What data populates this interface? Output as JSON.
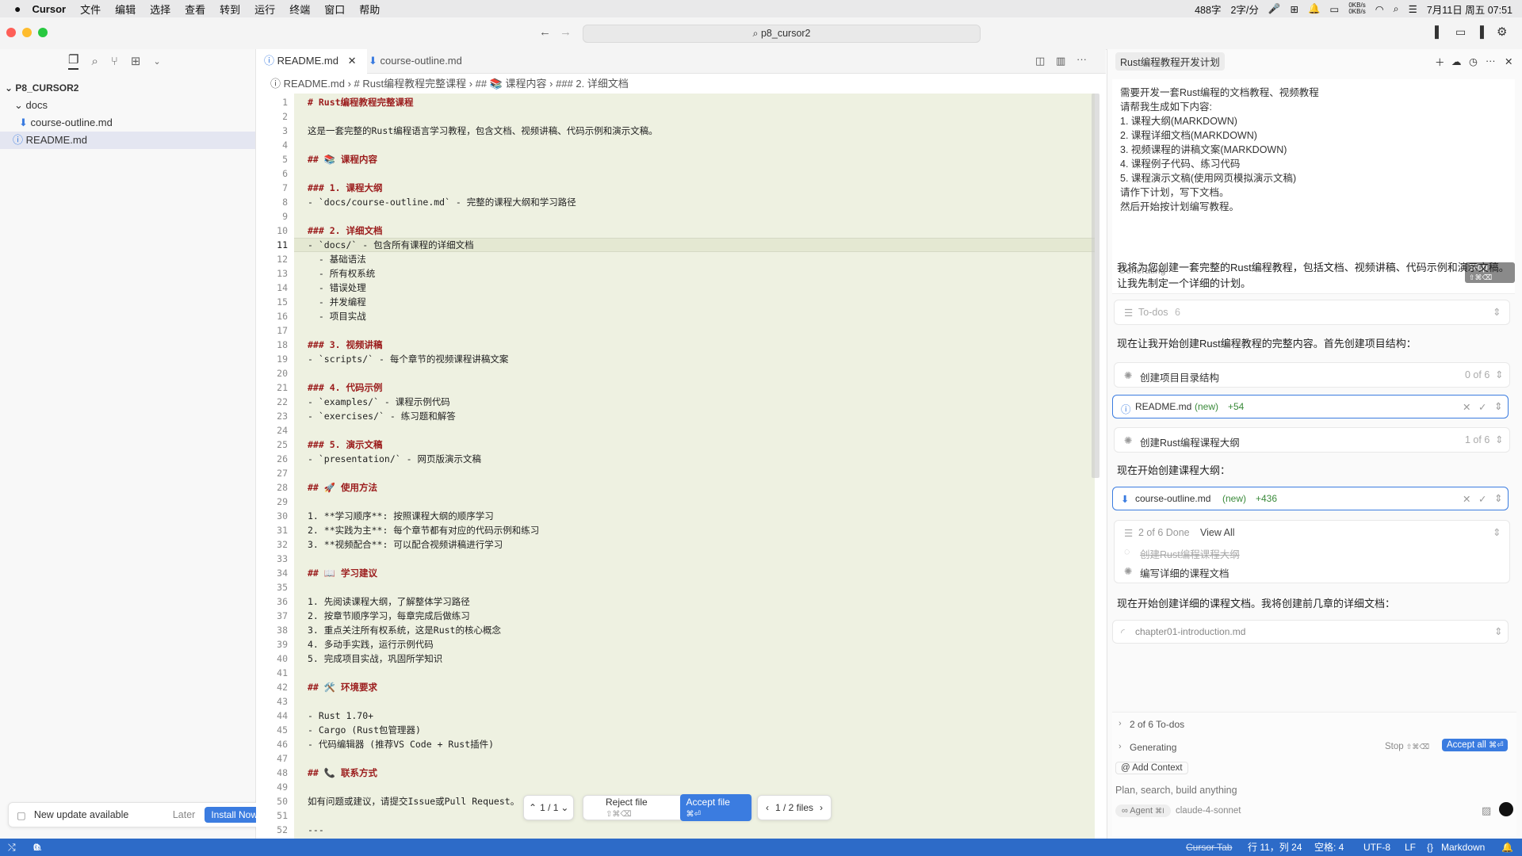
{
  "menubar": {
    "app": "Cursor",
    "items": [
      "文件",
      "编辑",
      "选择",
      "查看",
      "转到",
      "运行",
      "终端",
      "窗口",
      "帮助"
    ],
    "word_count": "488字",
    "speed": "2字/分",
    "net_up": "0KB/s",
    "net_down": "0KB/s",
    "datetime": "7月11日 周五 07:51"
  },
  "titlebar": {
    "project": "p8_cursor2"
  },
  "sidebar": {
    "root": "P8_CURSOR2",
    "folder": "docs",
    "file_in_folder": "course-outline.md",
    "file_root": "README.md",
    "update_text": "New update available",
    "later": "Later",
    "install": "Install Now"
  },
  "editor": {
    "tabs": [
      {
        "label": "README.md"
      },
      {
        "label": "course-outline.md"
      }
    ],
    "breadcrumb": {
      "file": "README.md",
      "h1": "# Rust编程教程完整课程",
      "h2": "## 📚 课程内容",
      "h3": "### 2. 详细文档"
    },
    "current_line": 11,
    "lines": [
      {
        "n": "1",
        "t": "# Rust编程教程完整课程",
        "h": true
      },
      {
        "n": "2",
        "t": ""
      },
      {
        "n": "3",
        "t": "这是一套完整的Rust编程语言学习教程，包含文档、视频讲稿、代码示例和演示文稿。"
      },
      {
        "n": "4",
        "t": ""
      },
      {
        "n": "5",
        "t": "## 📚 课程内容",
        "h": true
      },
      {
        "n": "6",
        "t": ""
      },
      {
        "n": "7",
        "t": "### 1. 课程大纲",
        "h": true
      },
      {
        "n": "8",
        "t": "- `docs/course-outline.md` - 完整的课程大纲和学习路径"
      },
      {
        "n": "9",
        "t": ""
      },
      {
        "n": "10",
        "t": "### 2. 详细文档",
        "h": true
      },
      {
        "n": "11",
        "t": "- `docs/` - 包含所有课程的详细文档"
      },
      {
        "n": "12",
        "t": "  - 基础语法"
      },
      {
        "n": "13",
        "t": "  - 所有权系统"
      },
      {
        "n": "14",
        "t": "  - 错误处理"
      },
      {
        "n": "15",
        "t": "  - 并发编程"
      },
      {
        "n": "16",
        "t": "  - 项目实战"
      },
      {
        "n": "17",
        "t": ""
      },
      {
        "n": "18",
        "t": "### 3. 视频讲稿",
        "h": true
      },
      {
        "n": "19",
        "t": "- `scripts/` - 每个章节的视频课程讲稿文案"
      },
      {
        "n": "20",
        "t": ""
      },
      {
        "n": "21",
        "t": "### 4. 代码示例",
        "h": true
      },
      {
        "n": "22",
        "t": "- `examples/` - 课程示例代码"
      },
      {
        "n": "23",
        "t": "- `exercises/` - 练习题和解答"
      },
      {
        "n": "24",
        "t": ""
      },
      {
        "n": "25",
        "t": "### 5. 演示文稿",
        "h": true
      },
      {
        "n": "26",
        "t": "- `presentation/` - 网页版演示文稿"
      },
      {
        "n": "27",
        "t": ""
      },
      {
        "n": "28",
        "t": "## 🚀 使用方法",
        "h": true
      },
      {
        "n": "29",
        "t": ""
      },
      {
        "n": "30",
        "t": "1. **学习顺序**: 按照课程大纲的顺序学习"
      },
      {
        "n": "31",
        "t": "2. **实践为主**: 每个章节都有对应的代码示例和练习"
      },
      {
        "n": "32",
        "t": "3. **视频配合**: 可以配合视频讲稿进行学习"
      },
      {
        "n": "33",
        "t": ""
      },
      {
        "n": "34",
        "t": "## 📖 学习建议",
        "h": true
      },
      {
        "n": "35",
        "t": ""
      },
      {
        "n": "36",
        "t": "1. 先阅读课程大纲，了解整体学习路径"
      },
      {
        "n": "37",
        "t": "2. 按章节顺序学习，每章完成后做练习"
      },
      {
        "n": "38",
        "t": "3. 重点关注所有权系统，这是Rust的核心概念"
      },
      {
        "n": "39",
        "t": "4. 多动手实践，运行示例代码"
      },
      {
        "n": "40",
        "t": "5. 完成项目实战，巩固所学知识"
      },
      {
        "n": "41",
        "t": ""
      },
      {
        "n": "42",
        "t": "## 🛠️ 环境要求",
        "h": true
      },
      {
        "n": "43",
        "t": ""
      },
      {
        "n": "44",
        "t": "- Rust 1.70+"
      },
      {
        "n": "45",
        "t": "- Cargo (Rust包管理器)"
      },
      {
        "n": "46",
        "t": "- 代码编辑器 (推荐VS Code + Rust插件)"
      },
      {
        "n": "47",
        "t": ""
      },
      {
        "n": "48",
        "t": "## 📞 联系方式",
        "h": true
      },
      {
        "n": "49",
        "t": ""
      },
      {
        "n": "50",
        "t": "如有问题或建议，请提交Issue或Pull Request。"
      },
      {
        "n": "51",
        "t": ""
      },
      {
        "n": "52",
        "t": "---"
      }
    ],
    "diff_nav": {
      "hunk": "1 / 1",
      "reject": "Reject file",
      "reject_kbd": "⇧⌘⌫",
      "accept": "Accept file",
      "accept_kbd": "⌘⏎",
      "files": "1 / 2 files"
    }
  },
  "chat": {
    "title": "Rust编程教程开发计划",
    "prompt_lines": [
      "需要开发一套Rust编程的文档教程、视频教程",
      "请帮我生成如下内容:",
      "1. 课程大纲(MARKDOWN)",
      "2. 课程详细文档(MARKDOWN)",
      "3. 视频课程的讲稿文案(MARKDOWN)",
      "4. 课程例子代码、练习代码",
      "5. 课程演示文稿(使用网页模拟演示文稿)",
      "请作下计划，写下文档。",
      "然后开始按计划编写教程。"
    ],
    "generating": "Generating",
    "stop": "Stop",
    "stop_kbd": "⇧⌘⌫",
    "reply1": "我将为您创建一套完整的Rust编程教程，包括文档、视频讲稿、代码示例和演示文稿。让我先制定一个详细的计划。",
    "todos_label": "To-dos",
    "todos_count": "6",
    "reply2": "现在让我开始创建Rust编程教程的完整内容。首先创建项目结构：",
    "task1": "创建项目目录结构",
    "task1_progress": "0 of 6",
    "file1_name": "README.md",
    "file1_tag": "(new)",
    "file1_diff": "+54",
    "task2": "创建Rust编程课程大纲",
    "task2_progress": "1 of 6",
    "reply3": "现在开始创建课程大纲：",
    "file2_name": "course-outline.md",
    "file2_tag": "(new)",
    "file2_diff": "+436",
    "done_label": "2 of 6 Done",
    "view_all": "View All",
    "done_item": "创建Rust编程课程大纲",
    "pending_item": "编写详细的课程文档",
    "reply4": "现在开始创建详细的课程文档。我将创建前几章的详细文档：",
    "file3_name": "chapter01-introduction.md",
    "todos_summary": "2 of 6 To-dos",
    "generating2": "Generating",
    "stop2": "Stop",
    "stop2_kbd": "⇧⌘⌫",
    "accept_all": "Accept all",
    "accept_all_kbd": "⌘⏎",
    "add_context": "Add Context",
    "input_placeholder": "Plan, search, build anything",
    "agent_label": "Agent",
    "agent_kbd": "⌘I",
    "model": "claude-4-sonnet"
  },
  "statusbar": {
    "errors": "0",
    "warnings": "0",
    "cursor_tab": "Cursor Tab",
    "position": "行 11，列 24",
    "spaces": "空格: 4",
    "encoding": "UTF-8",
    "eol": "LF",
    "language": "Markdown"
  },
  "colors": {
    "accent": "#3b7ce0",
    "statusbar": "#2d6bc8",
    "heading": "#9b1c1c"
  }
}
